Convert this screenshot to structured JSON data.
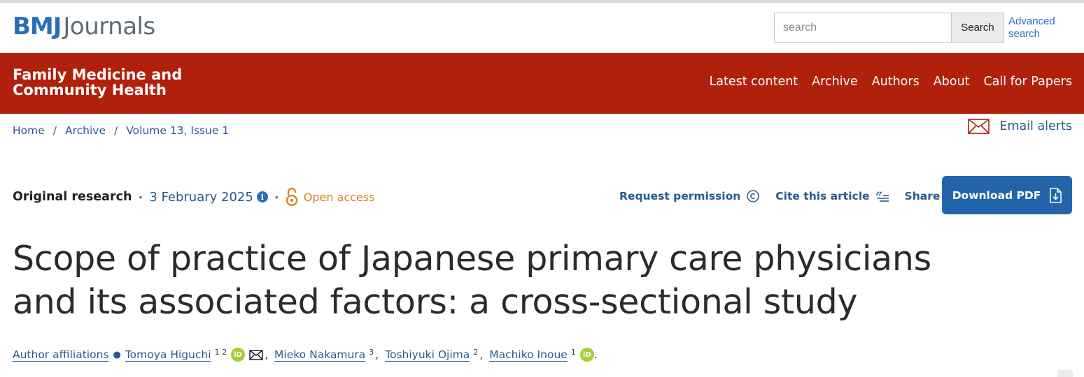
{
  "header": {
    "logo_bmj": "BMJ",
    "logo_journals": "Journals",
    "search_placeholder": "search",
    "search_button": "Search",
    "advanced_search": "Advanced search"
  },
  "journal": {
    "title": "Family Medicine and Community Health"
  },
  "nav": {
    "items": [
      "Latest content",
      "Archive",
      "Authors",
      "About",
      "Call for Papers"
    ]
  },
  "breadcrumb": [
    "Home",
    "Archive",
    "Volume 13, Issue 1"
  ],
  "email_alerts": "Email alerts",
  "meta": {
    "article_type": "Original research",
    "date": "3 February 2025",
    "info_glyph": "i",
    "open_access": "Open access"
  },
  "actions": {
    "request_permission": "Request permission",
    "cite": "Cite this article",
    "share": "Share",
    "download_pdf": "Download PDF"
  },
  "article": {
    "title": "Scope of practice of Japanese primary care physicians and its associated factors: a cross-sectional study"
  },
  "authors": {
    "affiliations_link": "Author affiliations",
    "orcid_glyph": "iD",
    "list": [
      {
        "name": "Tomoya Higuchi",
        "sup": "1 2"
      },
      {
        "name": "Mieko Nakamura",
        "sup": "3"
      },
      {
        "name": "Toshiyuki Ojima",
        "sup": "2"
      },
      {
        "name": "Machiko Inoue",
        "sup": "1"
      }
    ]
  },
  "colors": {
    "brand_red": "#b0200a",
    "link_blue": "#2a5a8c",
    "button_blue": "#2465a9",
    "open_access_orange": "#d97f14",
    "orcid_green": "#a6ce39"
  }
}
